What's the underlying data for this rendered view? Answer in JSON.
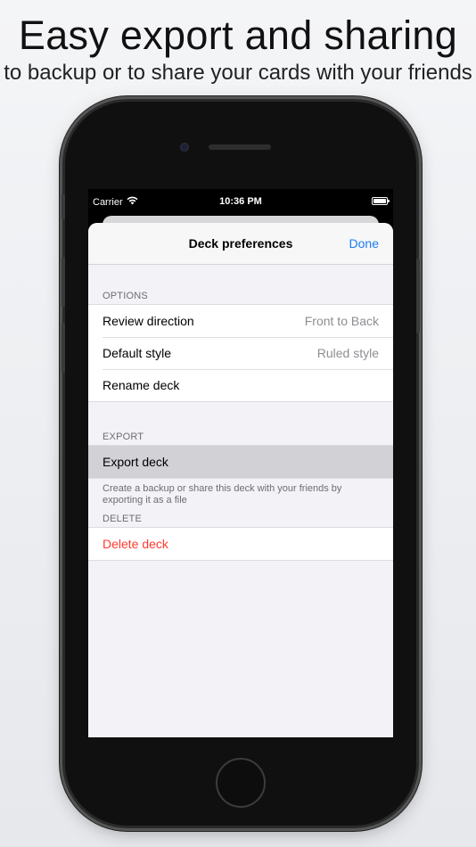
{
  "headline": "Easy export and sharing",
  "subline": "to backup or to share your cards with your friends",
  "status_bar": {
    "carrier": "Carrier",
    "time": "10:36 PM",
    "wifi_icon": "wifi-icon",
    "battery_icon": "battery-icon"
  },
  "navbar": {
    "title": "Deck preferences",
    "done_label": "Done"
  },
  "sections": {
    "options": {
      "header": "OPTIONS",
      "review_direction": {
        "label": "Review direction",
        "value": "Front to Back"
      },
      "default_style": {
        "label": "Default style",
        "value": "Ruled style"
      },
      "rename_deck": {
        "label": "Rename deck"
      }
    },
    "export": {
      "header": "EXPORT",
      "export_deck": {
        "label": "Export deck"
      },
      "footer": "Create a backup or share this deck with your friends by exporting it as a file"
    },
    "delete": {
      "header": "DELETE",
      "delete_deck": {
        "label": "Delete deck"
      }
    }
  },
  "colors": {
    "accent": "#1a7cf5",
    "destructive": "#ff3b30",
    "selected_row": "#d1d1d6",
    "grouped_background": "#f2f2f7"
  }
}
